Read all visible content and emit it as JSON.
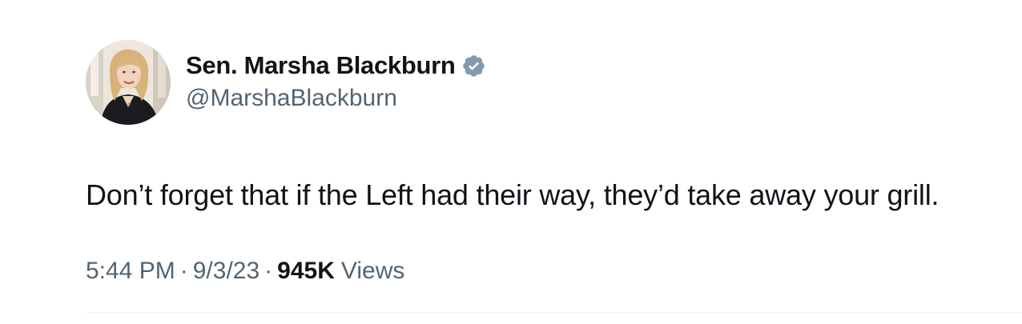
{
  "tweet": {
    "author": {
      "display_name": "Sen. Marsha Blackburn",
      "handle": "@MarshaBlackburn",
      "verified": true,
      "verified_badge_icon": "verified-badge-icon",
      "verified_badge_color": "#829aab"
    },
    "text": "Don’t forget that if the Left had their way, they’d take away your grill.",
    "meta": {
      "time": "5:44 PM",
      "separator": "·",
      "date": "9/3/23",
      "views_count": "945K",
      "views_label": "Views"
    }
  },
  "colors": {
    "primary_text": "#0f1419",
    "secondary_text": "#536471",
    "divider": "#eff3f4",
    "background": "#ffffff"
  }
}
